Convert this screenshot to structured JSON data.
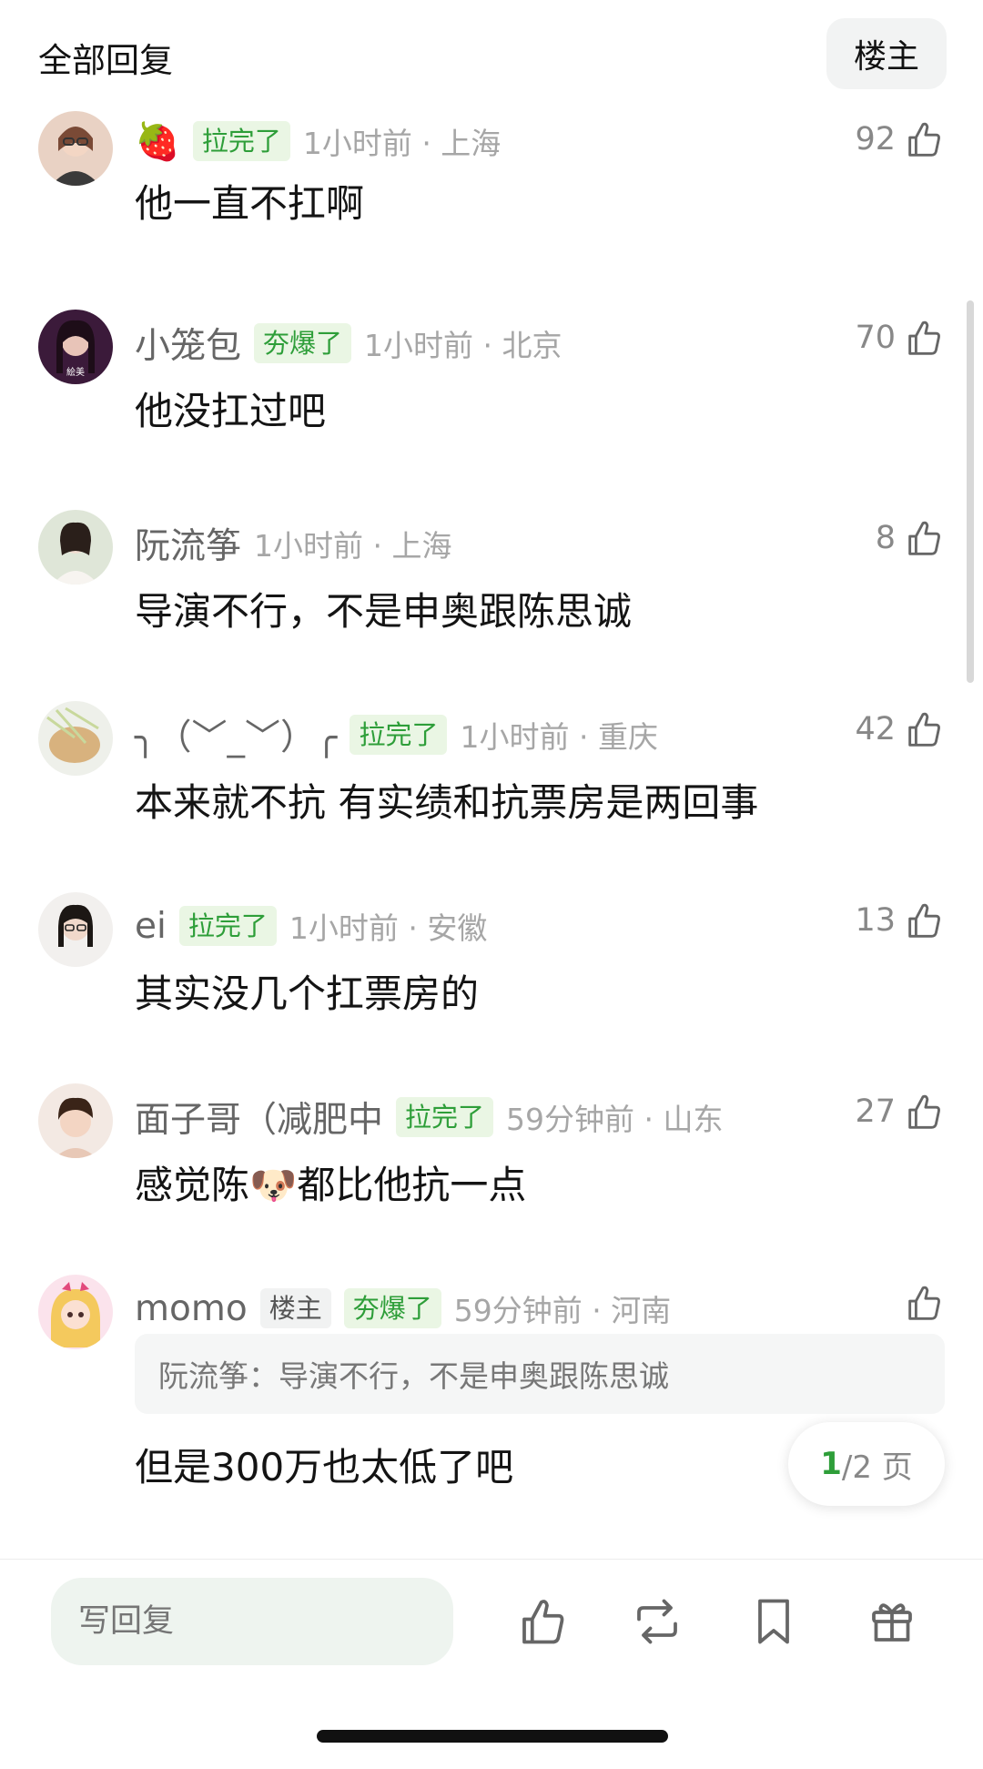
{
  "header": {
    "title": "全部回复",
    "op_filter_label": "楼主"
  },
  "comments": [
    {
      "username": "",
      "user_emoji": "🍓",
      "badges": [
        {
          "text": "拉完了",
          "style": "green"
        }
      ],
      "time_loc": "1小时前 · 上海",
      "likes": "92",
      "text": "他一直不扛啊"
    },
    {
      "username": "小笼包",
      "badges": [
        {
          "text": "夯爆了",
          "style": "green"
        }
      ],
      "time_loc": "1小时前 · 北京",
      "likes": "70",
      "text": "他没扛过吧"
    },
    {
      "username": "阮流筝",
      "badges": [],
      "time_loc": "1小时前 · 上海",
      "likes": "8",
      "text": "导演不行，不是申奥跟陈思诚"
    },
    {
      "username": "╮（﹀_﹀）╭",
      "badges": [
        {
          "text": "拉完了",
          "style": "green"
        }
      ],
      "time_loc": "1小时前 · 重庆",
      "likes": "42",
      "text": "本来就不抗 有实绩和抗票房是两回事"
    },
    {
      "username": "ei",
      "badges": [
        {
          "text": "拉完了",
          "style": "green"
        }
      ],
      "time_loc": "1小时前 · 安徽",
      "likes": "13",
      "text": "其实没几个扛票房的"
    },
    {
      "username": "面子哥（减肥中",
      "badges": [
        {
          "text": "拉完了",
          "style": "green"
        }
      ],
      "time_loc": "59分钟前 · 山东",
      "likes": "27",
      "text_before": "感觉陈",
      "text_emoji": "🐶",
      "text_after": "都比他抗一点"
    },
    {
      "username": "momo",
      "badges": [
        {
          "text": "楼主",
          "style": "gray"
        },
        {
          "text": "夯爆了",
          "style": "green"
        }
      ],
      "time_loc": "59分钟前 · 河南",
      "likes": "",
      "quote": "阮流筝：导演不行，不是申奥跟陈思诚",
      "text": "但是300万也太低了吧"
    }
  ],
  "pagination": {
    "current": "1",
    "total_text": "/2 页"
  },
  "bottom_bar": {
    "reply_placeholder": "写回复"
  },
  "colors": {
    "accent_green": "#2e9e39",
    "badge_bg": "#eaf6e4"
  },
  "icons": [
    "thumbs-up-icon",
    "repost-icon",
    "bookmark-icon",
    "gift-icon"
  ]
}
